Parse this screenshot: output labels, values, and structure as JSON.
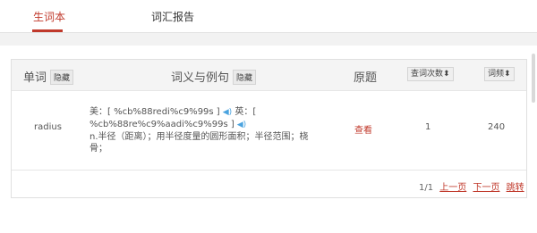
{
  "tabs": [
    {
      "label": "生词本",
      "active": true
    },
    {
      "label": "词汇报告",
      "active": false
    }
  ],
  "table": {
    "headers": {
      "word": "单词",
      "word_hide": "隐藏",
      "meaning": "词义与例句",
      "meaning_hide": "隐藏",
      "source": "原题",
      "query_count": "查词次数",
      "frequency": "词频"
    },
    "rows": [
      {
        "word": "radius",
        "us_label": "美：[ %cb%88redi%c9%99s ]",
        "uk_label": "英：[",
        "uk_phonetic": "%cb%88re%c9%aadi%c9%99s ]",
        "definition": "n.半径（距离）；用半径度量的圆形面积；半径范围；桡骨；",
        "view": "查看",
        "query_count": "1",
        "frequency": "240"
      }
    ]
  },
  "pager": {
    "page_info": "1/1",
    "prev": "上一页",
    "next": "下一页",
    "jump": "跳转"
  },
  "icons": {
    "sort": "sort-icon",
    "speaker": "speaker-icon"
  },
  "colors": {
    "accent": "#c0392b",
    "speaker": "#4aa3df"
  }
}
